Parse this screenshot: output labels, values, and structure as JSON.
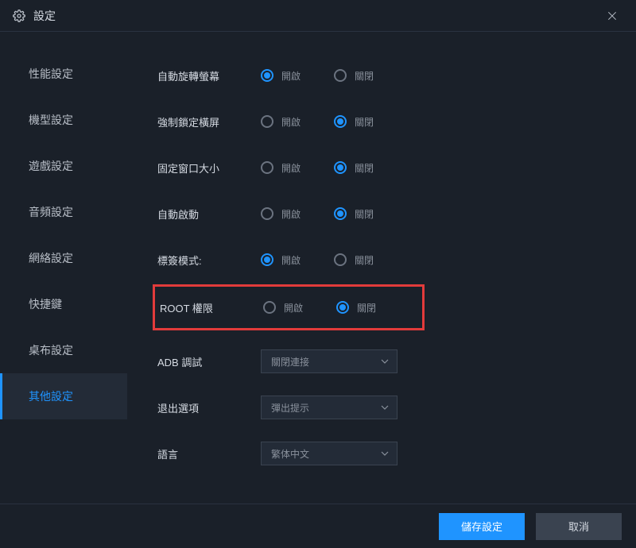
{
  "window": {
    "title": "設定"
  },
  "sidebar": {
    "items": [
      {
        "label": "性能設定"
      },
      {
        "label": "機型設定"
      },
      {
        "label": "遊戲設定"
      },
      {
        "label": "音頻設定"
      },
      {
        "label": "網絡設定"
      },
      {
        "label": "快捷鍵"
      },
      {
        "label": "桌布設定"
      },
      {
        "label": "其他設定"
      }
    ],
    "activeIndex": 7
  },
  "options": {
    "on": "開啟",
    "off": "關閉"
  },
  "settings": {
    "autoRotate": {
      "label": "自動旋轉螢幕",
      "value": "on"
    },
    "forceLandscape": {
      "label": "強制鎖定橫屏",
      "value": "off"
    },
    "fixedWindow": {
      "label": "固定窗口大小",
      "value": "off"
    },
    "autoStart": {
      "label": "自動啟動",
      "value": "off"
    },
    "tabMode": {
      "label": "標簽模式:",
      "value": "on"
    },
    "root": {
      "label": "ROOT 權限",
      "value": "off"
    },
    "adb": {
      "label": "ADB 調試",
      "selected": "關閉連接"
    },
    "exit": {
      "label": "退出選項",
      "selected": "彈出提示"
    },
    "lang": {
      "label": "語言",
      "selected": "繁体中文"
    }
  },
  "footer": {
    "save": "儲存設定",
    "cancel": "取消"
  }
}
